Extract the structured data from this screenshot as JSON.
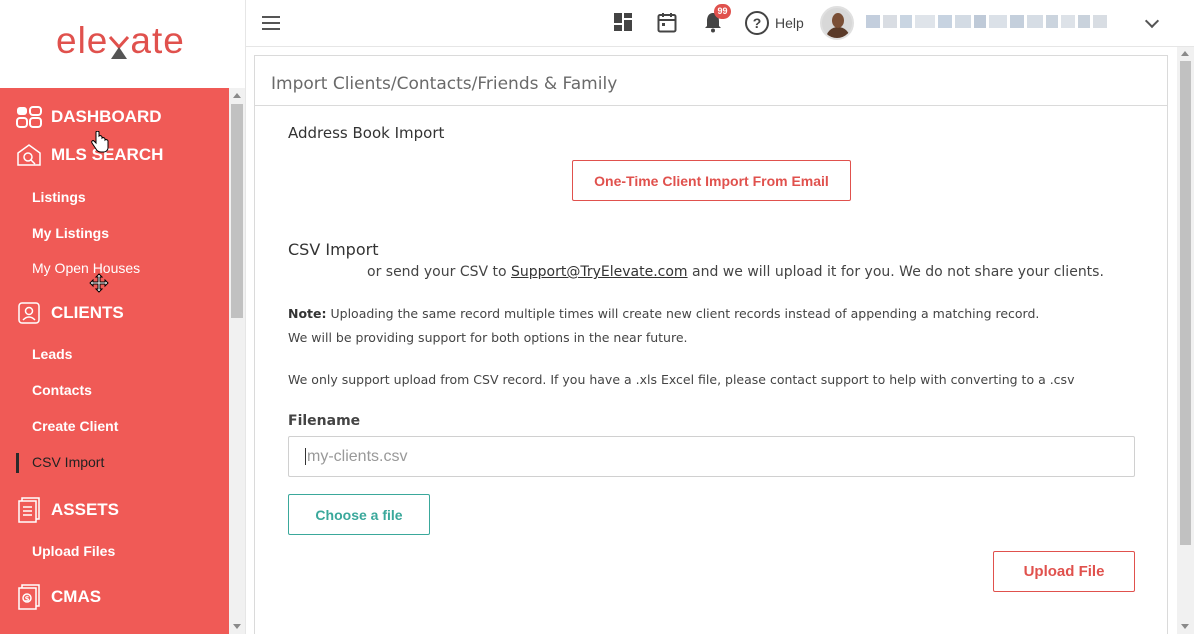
{
  "brand": {
    "logo_text": "ele",
    "logo_text2": "ate",
    "color": "#f05a56"
  },
  "sidebar": {
    "sections": [
      {
        "label": "DASHBOARD",
        "icon": "dashboard-icon"
      },
      {
        "label": "MLS SEARCH",
        "icon": "house-search-icon"
      },
      {
        "label": "CLIENTS",
        "icon": "clients-icon"
      },
      {
        "label": "ASSETS",
        "icon": "documents-icon"
      },
      {
        "label": "CMAS",
        "icon": "cma-icon"
      }
    ],
    "mls_items": [
      "Listings",
      "My Listings",
      "My Open Houses"
    ],
    "client_items": [
      "Leads",
      "Contacts",
      "Create Client",
      "CSV Import"
    ],
    "asset_items": [
      "Upload Files"
    ],
    "active_item": "CSV Import"
  },
  "topbar": {
    "notification_count": "99",
    "help_label": "Help",
    "help_symbol": "?"
  },
  "page": {
    "title": "Import Clients/Contacts/Friends & Family",
    "address_book_heading": "Address Book Import",
    "email_import_button": "One-Time Client Import From Email",
    "csv_heading": "CSV Import",
    "send_prefix": "or send your CSV to ",
    "support_email": "Support@TryElevate.com",
    "send_suffix": " and we will upload it for you. We do not share your clients.",
    "note_label": "Note:",
    "note_text": " Uploading the same record multiple times will create new client records instead of appending a matching record.",
    "note_line2": "We will be providing support for both options in the near future.",
    "support_note": "We only support upload from CSV record. If you have a .xls Excel file, please contact support to help with converting to a .csv",
    "filename_label": "Filename",
    "filename_placeholder": "my-clients.csv",
    "choose_file_button": "Choose a file",
    "upload_button": "Upload File"
  }
}
